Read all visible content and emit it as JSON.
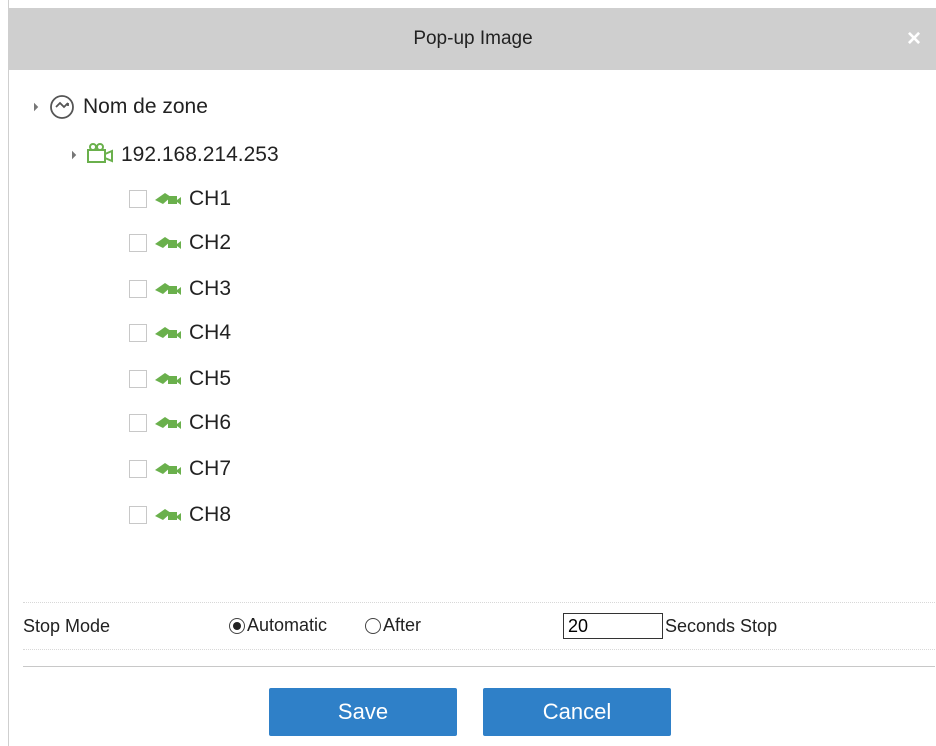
{
  "dialog": {
    "title": "Pop-up Image",
    "close_glyph": "×"
  },
  "tree": {
    "zone": {
      "label": "Nom de zone",
      "icon": "zone-icon"
    },
    "device": {
      "label": "192.168.214.253",
      "icon": "camera-device-icon"
    },
    "channels": [
      "CH1",
      "CH2",
      "CH3",
      "CH4",
      "CH5",
      "CH6",
      "CH7",
      "CH8"
    ]
  },
  "stop_mode": {
    "label": "Stop Mode",
    "options": [
      {
        "label": "Automatic",
        "selected": true
      },
      {
        "label": "After",
        "selected": false
      }
    ],
    "seconds_value": "20",
    "seconds_suffix": "Seconds Stop"
  },
  "buttons": {
    "save_label": "Save",
    "cancel_label": "Cancel"
  },
  "colors": {
    "accent": "#2f80c8",
    "titlebar": "#cfcfcf",
    "icon_green": "#6ab04c"
  }
}
